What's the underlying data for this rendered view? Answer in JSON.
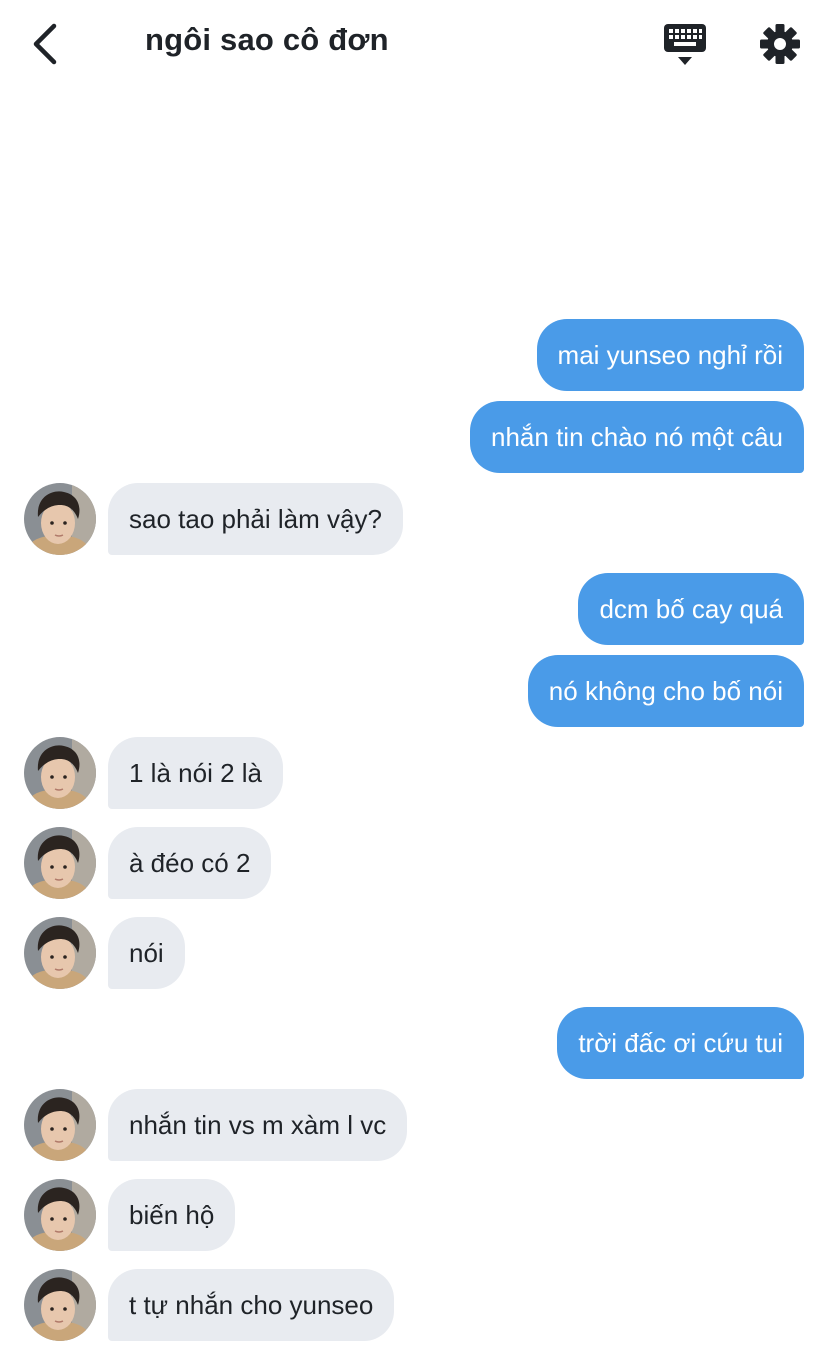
{
  "header": {
    "title": "ngôi sao cô đơn",
    "back_icon": "chevron-left-icon",
    "keyboard_icon": "keyboard-icon",
    "settings_icon": "gear-icon"
  },
  "colors": {
    "outgoing_bubble": "#4a9be8",
    "incoming_bubble": "#e8ebf0",
    "text_dark": "#1f2328"
  },
  "messages": [
    {
      "side": "out",
      "text": "mai yunseo nghỉ rồi"
    },
    {
      "side": "out",
      "text": "nhắn tin chào nó một câu"
    },
    {
      "side": "in",
      "text": "sao tao phải làm vậy?"
    },
    {
      "side": "out",
      "text": "dcm bố cay quá"
    },
    {
      "side": "out",
      "text": "nó không cho bố nói"
    },
    {
      "side": "in",
      "text": "1 là nói 2 là"
    },
    {
      "side": "in",
      "text": "à đéo có 2"
    },
    {
      "side": "in",
      "text": "nói"
    },
    {
      "side": "out",
      "text": "trời đấc ơi cứu tui"
    },
    {
      "side": "in",
      "text": "nhắn tin vs m xàm l vc"
    },
    {
      "side": "in",
      "text": "biến hộ"
    },
    {
      "side": "in",
      "text": "t tự nhắn cho yunseo"
    }
  ]
}
